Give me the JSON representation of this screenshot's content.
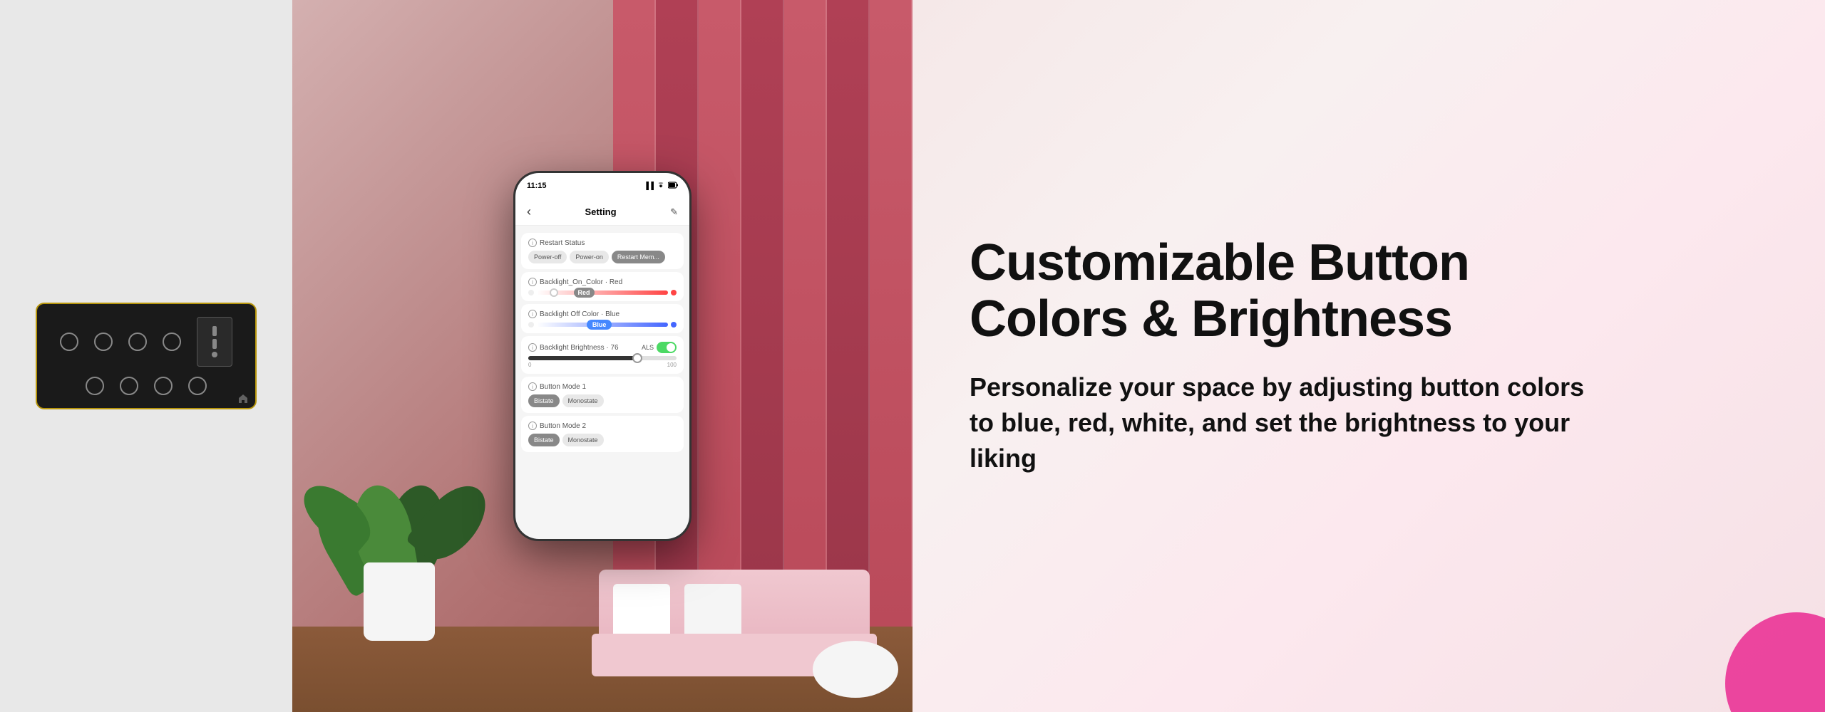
{
  "left_panel": {
    "device_alt": "Smart Switch Panel"
  },
  "phone": {
    "status_bar": {
      "time": "11:15",
      "signal": "▐▐",
      "wifi": "WiFi",
      "battery": "🔋"
    },
    "header": {
      "title": "Setting",
      "back_icon": "‹",
      "edit_icon": "✎"
    },
    "restart_status": {
      "label": "Restart Status",
      "options": [
        "Power-off",
        "Power-on",
        "Restart Mem..."
      ],
      "active": 2
    },
    "backlight_on_color": {
      "label": "Backlight_On_Color",
      "value": "Red",
      "color_pill": "Red",
      "pill_bg": "#888888"
    },
    "backlight_off_color": {
      "label": "Backlight Off Color",
      "value": "Blue",
      "color_pill": "Blue",
      "pill_bg": "#4488ff"
    },
    "backlight_brightness": {
      "label": "Backlight Brightness",
      "value": "76",
      "als_label": "ALS",
      "als_on": true,
      "min": "0",
      "max": "100",
      "fill_percent": 72
    },
    "button_mode_1": {
      "label": "Button Mode 1",
      "options": [
        "Bistate",
        "Monostate"
      ],
      "active": 0
    },
    "button_mode_2": {
      "label": "Button Mode 2",
      "options": [
        "Bistate",
        "Monostate"
      ],
      "active": 0
    }
  },
  "right_panel": {
    "headline_line1": "Customizable Button",
    "headline_line2": "Colors & Brightness",
    "subheadline": "Personalize your space by adjusting button colors to blue, red, white, and set the brightness to your liking"
  }
}
